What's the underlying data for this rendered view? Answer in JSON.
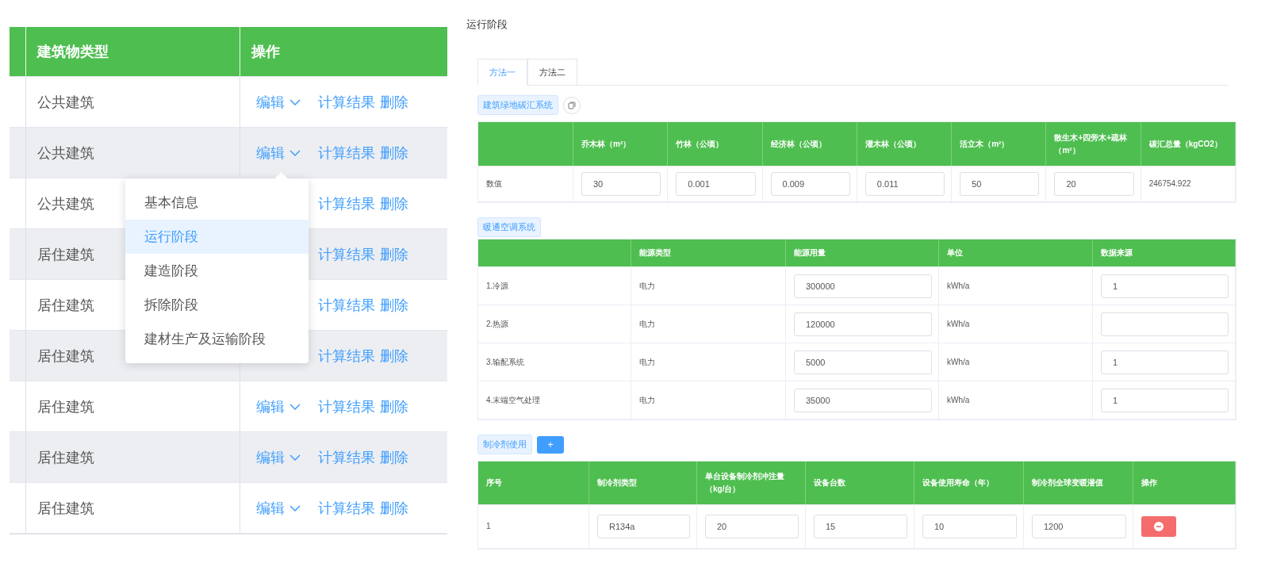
{
  "building_table": {
    "columns": [
      "建筑物类型",
      "操作"
    ],
    "rows": [
      {
        "type": "公共建筑",
        "actions": [
          {
            "label": "编辑",
            "kind": "dropdown"
          },
          {
            "label": "计算结果",
            "kind": "link"
          },
          {
            "label": "删除",
            "kind": "link"
          }
        ]
      },
      {
        "type": "公共建筑",
        "actions": [
          {
            "label": "编辑",
            "kind": "dropdown"
          },
          {
            "label": "计算结果",
            "kind": "link"
          },
          {
            "label": "删除",
            "kind": "link"
          }
        ]
      },
      {
        "type": "公共建筑",
        "actions": [
          {
            "label": "计算结果",
            "kind": "link"
          },
          {
            "label": "删除",
            "kind": "link"
          }
        ]
      },
      {
        "type": "居住建筑",
        "actions": [
          {
            "label": "计算结果",
            "kind": "link"
          },
          {
            "label": "删除",
            "kind": "link"
          }
        ]
      },
      {
        "type": "居住建筑",
        "actions": [
          {
            "label": "计算结果",
            "kind": "link"
          },
          {
            "label": "删除",
            "kind": "link"
          }
        ]
      },
      {
        "type": "居住建筑",
        "actions": [
          {
            "label": "计算结果",
            "kind": "link"
          },
          {
            "label": "删除",
            "kind": "link"
          }
        ]
      },
      {
        "type": "居住建筑",
        "actions": [
          {
            "label": "编辑",
            "kind": "dropdown"
          },
          {
            "label": "计算结果",
            "kind": "link"
          },
          {
            "label": "删除",
            "kind": "link"
          }
        ]
      },
      {
        "type": "居住建筑",
        "actions": [
          {
            "label": "编辑",
            "kind": "dropdown"
          },
          {
            "label": "计算结果",
            "kind": "link"
          },
          {
            "label": "删除",
            "kind": "link"
          }
        ]
      },
      {
        "type": "居住建筑",
        "actions": [
          {
            "label": "编辑",
            "kind": "dropdown"
          },
          {
            "label": "计算结果",
            "kind": "link"
          },
          {
            "label": "删除",
            "kind": "link"
          }
        ]
      }
    ]
  },
  "edit_menu": [
    {
      "label": "基本信息",
      "selected": false
    },
    {
      "label": "运行阶段",
      "selected": true
    },
    {
      "label": "建造阶段",
      "selected": false
    },
    {
      "label": "拆除阶段",
      "selected": false
    },
    {
      "label": "建材生产及运输阶段",
      "selected": false
    }
  ],
  "page_title": "运行阶段",
  "tabs": [
    {
      "label": "方法一",
      "selected": true
    },
    {
      "label": "方法二",
      "selected": false
    }
  ],
  "green_space": {
    "tag": "建筑绿地碳汇系统",
    "columns": [
      "乔木林（m²）",
      "竹林（公顷）",
      "经济林（公顷）",
      "灌木林（公顷）",
      "活立木（m²）",
      "散生木+四旁木+疏林（m²）",
      "碳汇总量（kgCO2）"
    ],
    "row_label": "数值",
    "values": [
      "30",
      "0.001",
      "0.009",
      "0.011",
      "50",
      "20"
    ],
    "total": "246754.922"
  },
  "hvac": {
    "tag": "暖通空调系统",
    "columns": [
      "能源类型",
      "能源用量",
      "单位",
      "数据来源"
    ],
    "rows": [
      {
        "item": "1.冷源",
        "energy_type": "电力",
        "usage": "300000",
        "unit": "kWh/a",
        "source": "1"
      },
      {
        "item": "2.热源",
        "energy_type": "电力",
        "usage": "120000",
        "unit": "kWh/a"
      },
      {
        "item": "3.输配系统",
        "energy_type": "电力",
        "usage": "5000",
        "unit": "kWh/a",
        "source": "1"
      },
      {
        "item": "4.末端空气处理",
        "energy_type": "电力",
        "usage": "35000",
        "unit": "kWh/a",
        "source": "1"
      }
    ]
  },
  "refrigerant": {
    "tag": "制冷剂使用",
    "add_button": "+",
    "columns": [
      "序号",
      "制冷剂类型",
      "单台设备制冷剂冲注量（kg/台）",
      "设备台数",
      "设备使用寿命（年）",
      "制冷剂全球变暖潜值",
      "操作"
    ],
    "rows": [
      {
        "index": "1",
        "values": [
          "R134a",
          "20",
          "15",
          "10",
          "1200"
        ]
      }
    ]
  }
}
